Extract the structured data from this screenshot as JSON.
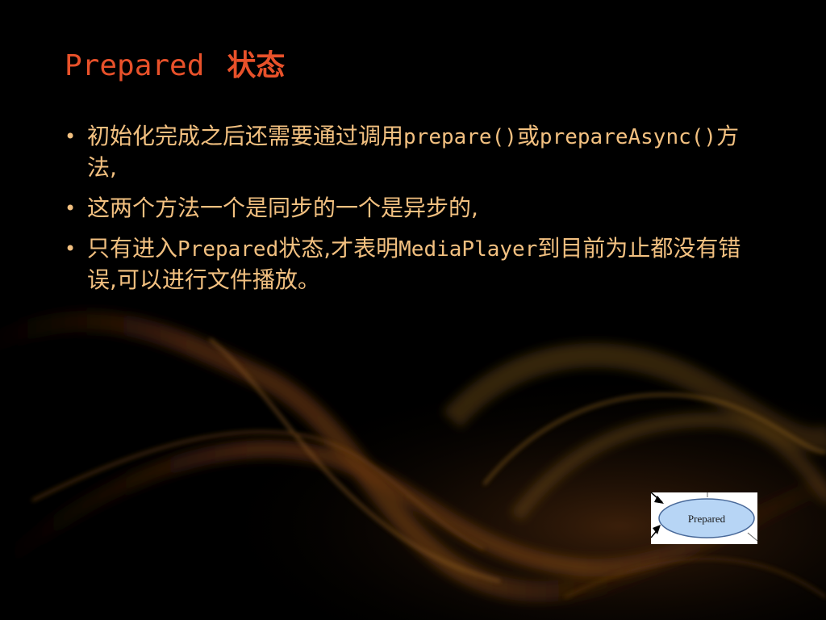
{
  "colors": {
    "background": "#000000",
    "title": "#e8512a",
    "body_text": "#f2c080",
    "bullet": "#f2c080",
    "diagram_node_fill": "#b7d5f5",
    "diagram_node_stroke": "#4a6a9a"
  },
  "slide": {
    "title_en": "Prepared",
    "title_zh": "状态",
    "bullets": [
      {
        "segments": [
          {
            "text": "初始化完成之后还需要通过调用",
            "mono": false
          },
          {
            "text": "prepare()",
            "mono": true
          },
          {
            "text": "或",
            "mono": false
          },
          {
            "text": "prepareAsync()",
            "mono": true
          },
          {
            "text": "方法,",
            "mono": false
          }
        ]
      },
      {
        "segments": [
          {
            "text": "这两个方法一个是同步的一个是异步的,",
            "mono": false
          }
        ]
      },
      {
        "segments": [
          {
            "text": "只有进入",
            "mono": false
          },
          {
            "text": "Prepared",
            "mono": true
          },
          {
            "text": "状态,才表明",
            "mono": false
          },
          {
            "text": "MediaPlayer",
            "mono": true
          },
          {
            "text": "到目前为止都没有错误,可以进行文件播放。",
            "mono": false
          }
        ]
      }
    ]
  },
  "thumbnail": {
    "node_label": "Prepared",
    "icon": "state-diagram-thumbnail"
  }
}
